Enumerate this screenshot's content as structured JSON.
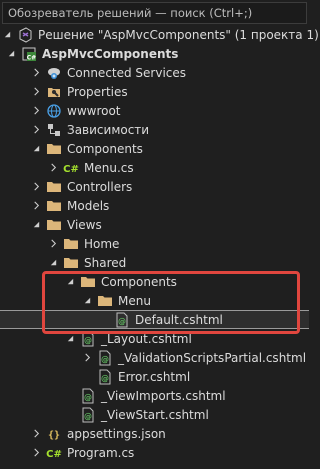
{
  "search": {
    "placeholder": "Обозреватель решений — поиск (Ctrl+;)"
  },
  "tree": [
    {
      "label": "Решение \"AspMvcComponents\" (1 проекта 1)",
      "icon": "solution-icon",
      "name": "solution-node"
    },
    {
      "label": "AspMvcComponents",
      "icon": "csharp-project-icon",
      "name": "project-node"
    },
    {
      "label": "Connected Services",
      "icon": "connected-services-icon",
      "name": "connected-services-node"
    },
    {
      "label": "Properties",
      "icon": "properties-icon",
      "name": "properties-node"
    },
    {
      "label": "wwwroot",
      "icon": "globe-icon",
      "name": "wwwroot-node"
    },
    {
      "label": "Зависимости",
      "icon": "dependencies-icon",
      "name": "dependencies-node"
    },
    {
      "label": "Components",
      "icon": "folder-icon",
      "name": "components-folder"
    },
    {
      "label": "Menu.cs",
      "icon": "csharp-file-icon",
      "name": "menu-cs-file"
    },
    {
      "label": "Controllers",
      "icon": "folder-icon",
      "name": "controllers-folder"
    },
    {
      "label": "Models",
      "icon": "folder-icon",
      "name": "models-folder"
    },
    {
      "label": "Views",
      "icon": "folder-icon",
      "name": "views-folder"
    },
    {
      "label": "Home",
      "icon": "folder-icon",
      "name": "home-folder"
    },
    {
      "label": "Shared",
      "icon": "folder-icon",
      "name": "shared-folder"
    },
    {
      "label": "Components",
      "icon": "folder-icon",
      "name": "shared-components-folder"
    },
    {
      "label": "Menu",
      "icon": "folder-icon",
      "name": "menu-folder"
    },
    {
      "label": "Default.cshtml",
      "icon": "razor-file-icon",
      "name": "default-cshtml-file"
    },
    {
      "label": "_Layout.cshtml",
      "icon": "razor-file-icon",
      "name": "layout-cshtml-file"
    },
    {
      "label": "_ValidationScriptsPartial.cshtml",
      "icon": "razor-file-icon",
      "name": "validation-scripts-file"
    },
    {
      "label": "Error.cshtml",
      "icon": "razor-file-icon",
      "name": "error-cshtml-file"
    },
    {
      "label": "_ViewImports.cshtml",
      "icon": "razor-file-icon",
      "name": "viewimports-file"
    },
    {
      "label": "_ViewStart.cshtml",
      "icon": "razor-file-icon",
      "name": "viewstart-file"
    },
    {
      "label": "appsettings.json",
      "icon": "json-file-icon",
      "name": "appsettings-file"
    },
    {
      "label": "Program.cs",
      "icon": "csharp-file-icon",
      "name": "program-cs-file"
    }
  ],
  "colors": {
    "background": "#1f1f1f",
    "folder": "#dcb67a",
    "highlight": "#e0463e",
    "razor": "#5fb55f",
    "csharp": "#a6e22e"
  }
}
